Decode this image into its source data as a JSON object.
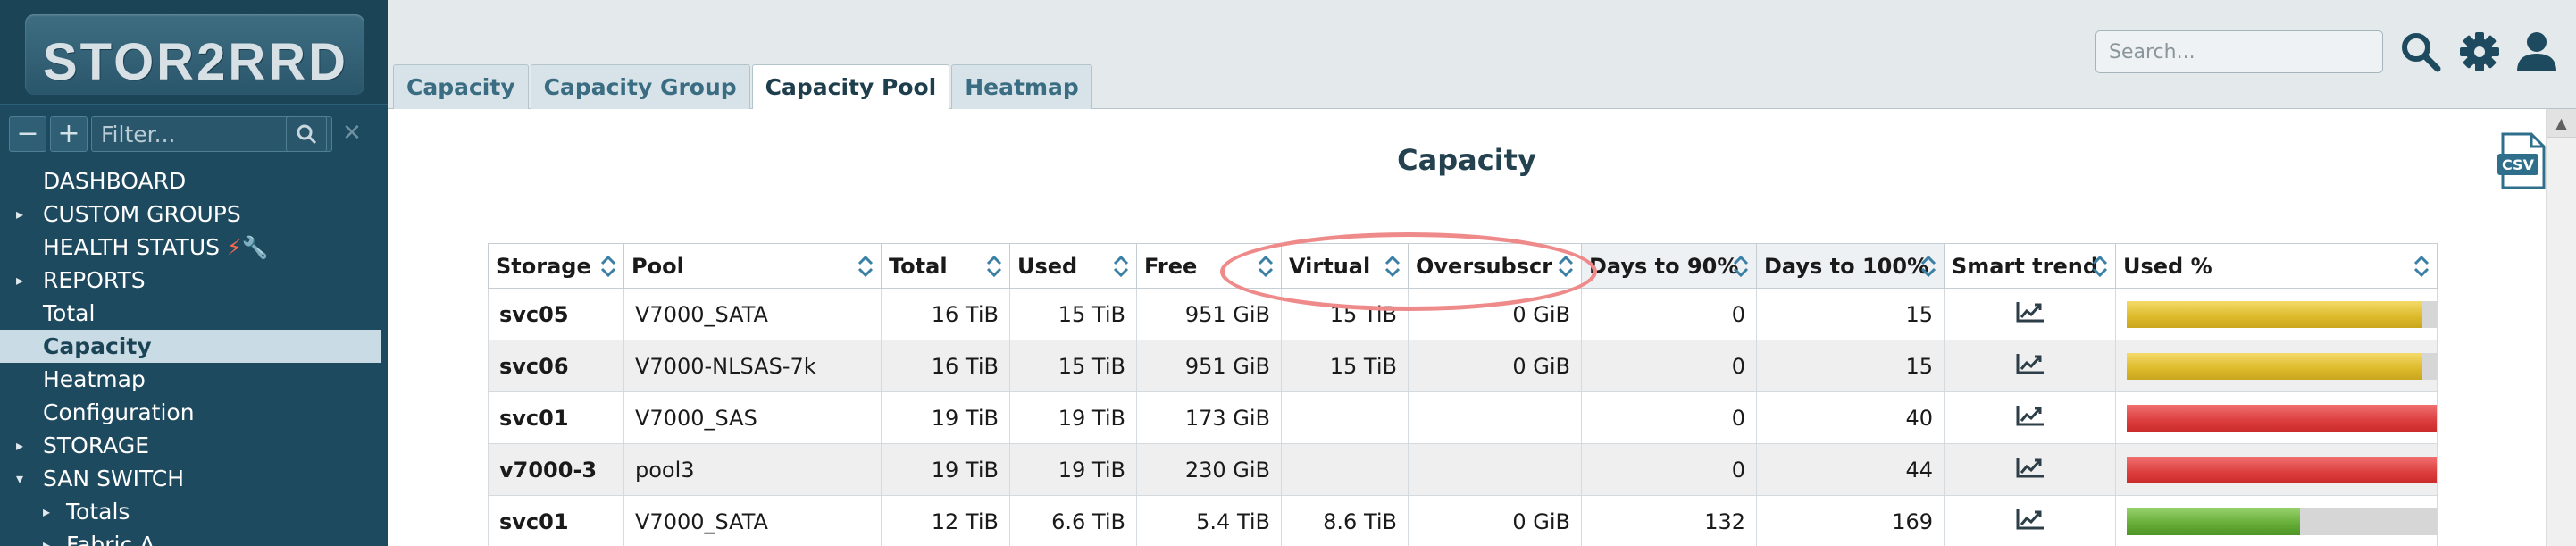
{
  "logo": {
    "text": "STOR2RRD"
  },
  "filter": {
    "placeholder": "Filter..."
  },
  "nav": [
    {
      "label": "DASHBOARD",
      "arrow": "",
      "level": 0
    },
    {
      "label": "CUSTOM GROUPS",
      "arrow": "▸",
      "level": 0
    },
    {
      "label": "HEALTH STATUS",
      "arrow": "",
      "level": 0
    },
    {
      "label": "REPORTS",
      "arrow": "▸",
      "level": 0
    },
    {
      "label": "Total",
      "arrow": "",
      "level": 0
    },
    {
      "label": "Capacity",
      "arrow": "",
      "level": 0,
      "active": true
    },
    {
      "label": "Heatmap",
      "arrow": "",
      "level": 0
    },
    {
      "label": "Configuration",
      "arrow": "",
      "level": 0
    },
    {
      "label": "STORAGE",
      "arrow": "▸",
      "level": 0
    },
    {
      "label": "SAN SWITCH",
      "arrow": "▾",
      "level": 0
    },
    {
      "label": "Totals",
      "arrow": "▸",
      "level": 1
    },
    {
      "label": "Fabric A",
      "arrow": "▸",
      "level": 1
    }
  ],
  "search": {
    "placeholder": "Search..."
  },
  "tabs": [
    {
      "label": "Capacity",
      "active": false
    },
    {
      "label": "Capacity Group",
      "active": false
    },
    {
      "label": "Capacity Pool",
      "active": true
    },
    {
      "label": "Heatmap",
      "active": false
    }
  ],
  "main": {
    "title": "Capacity",
    "csv_label": "CSV"
  },
  "table": {
    "columns": [
      "Storage",
      "Pool",
      "Total",
      "Used",
      "Free",
      "Virtual",
      "Oversubscr",
      "Days to 90%",
      "Days to 100%",
      "Smart trend",
      "Used %"
    ],
    "rows": [
      {
        "storage": "svc05",
        "pool": "V7000_SATA",
        "total": "16 TiB",
        "used": "15 TiB",
        "free": "951 GiB",
        "virtual": "15 TiB",
        "oversub": "0 GiB",
        "d90": "0",
        "d100": "15",
        "d90_red": true,
        "d100_red": true,
        "used_pct": 0.94,
        "bar_color": "yellow"
      },
      {
        "storage": "svc06",
        "pool": "V7000-NLSAS-7k",
        "total": "16 TiB",
        "used": "15 TiB",
        "free": "951 GiB",
        "virtual": "15 TiB",
        "oversub": "0 GiB",
        "d90": "0",
        "d100": "15",
        "d90_red": true,
        "d100_red": true,
        "used_pct": 0.94,
        "bar_color": "yellow"
      },
      {
        "storage": "svc01",
        "pool": "V7000_SAS",
        "total": "19 TiB",
        "used": "19 TiB",
        "free": "173 GiB",
        "virtual": "",
        "oversub": "",
        "d90": "0",
        "d100": "40",
        "d90_red": true,
        "d100_red": true,
        "used_pct": 0.99,
        "bar_color": "red"
      },
      {
        "storage": "v7000-3",
        "pool": "pool3",
        "total": "19 TiB",
        "used": "19 TiB",
        "free": "230 GiB",
        "virtual": "",
        "oversub": "",
        "d90": "0",
        "d100": "44",
        "d90_red": true,
        "d100_red": true,
        "used_pct": 0.99,
        "bar_color": "red"
      },
      {
        "storage": "svc01",
        "pool": "V7000_SATA",
        "total": "12 TiB",
        "used": "6.6 TiB",
        "free": "5.4 TiB",
        "virtual": "8.6 TiB",
        "oversub": "0 GiB",
        "d90": "132",
        "d100": "169",
        "d90_red": false,
        "d100_red": false,
        "used_pct": 0.55,
        "bar_color": "green"
      }
    ]
  }
}
